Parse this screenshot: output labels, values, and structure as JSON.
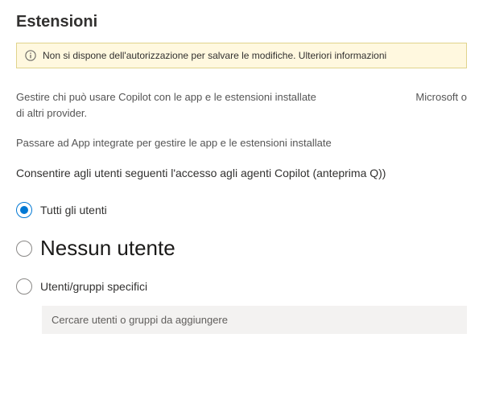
{
  "page": {
    "title": "Estensioni"
  },
  "banner": {
    "text": "Non si dispone dell'autorizzazione per salvare le modifiche. Ulteriori informazioni"
  },
  "description": {
    "line1_left": "Gestire chi può usare Copilot con le app e le estensioni installate",
    "line1_right": "Microsoft o",
    "line2": "di altri provider.",
    "sub": "Passare ad App integrate per gestire le app e le estensioni installate"
  },
  "section": {
    "label": "Consentire agli utenti seguenti l'accesso agli agenti Copilot (anteprima Q))"
  },
  "radios": {
    "all_users": "Tutti gli utenti",
    "no_users": "Nessun utente",
    "specific": "Utenti/gruppi specifici"
  },
  "search": {
    "placeholder": "Cercare utenti o gruppi da aggiungere"
  }
}
